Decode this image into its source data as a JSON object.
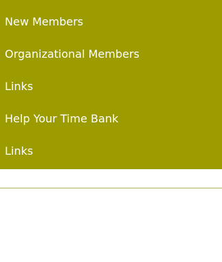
{
  "nav": {
    "items": [
      {
        "label": "New Members"
      },
      {
        "label": "Organizational Members"
      },
      {
        "label": "Links"
      },
      {
        "label": "Help Your Time Bank"
      },
      {
        "label": "Links"
      }
    ]
  },
  "colors": {
    "panel_background": "#9c9c00",
    "link_text": "#ffffff",
    "divider": "#b2b25a",
    "page_background": "#ffffff"
  }
}
